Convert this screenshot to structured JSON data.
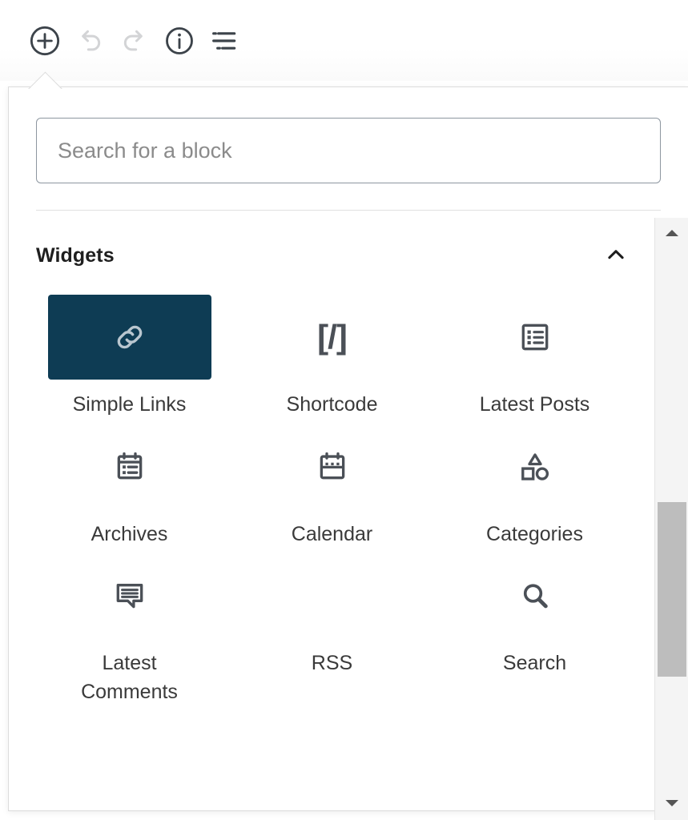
{
  "toolbar": {
    "buttons": [
      {
        "name": "add-block-button",
        "label": "Add block",
        "icon": "plus-circle-icon",
        "state": "active"
      },
      {
        "name": "undo-button",
        "label": "Undo",
        "icon": "undo-icon",
        "state": "disabled"
      },
      {
        "name": "redo-button",
        "label": "Redo",
        "icon": "redo-icon",
        "state": "disabled"
      },
      {
        "name": "details-button",
        "label": "Details",
        "icon": "info-circle-icon",
        "state": "enabled"
      },
      {
        "name": "list-view-button",
        "label": "List view",
        "icon": "list-view-icon",
        "state": "enabled"
      }
    ]
  },
  "inserter": {
    "search": {
      "placeholder": "Search for a block",
      "value": ""
    },
    "category": {
      "title": "Widgets",
      "expanded": true,
      "toggle_icon": "chevron-up-icon"
    },
    "blocks": [
      {
        "label": "Simple Links",
        "icon": "link-icon",
        "selected": true
      },
      {
        "label": "Shortcode",
        "icon": "shortcode-icon",
        "selected": false
      },
      {
        "label": "Latest Posts",
        "icon": "list-view-icon",
        "selected": false
      },
      {
        "label": "Archives",
        "icon": "archive-icon",
        "selected": false
      },
      {
        "label": "Calendar",
        "icon": "calendar-icon",
        "selected": false
      },
      {
        "label": "Categories",
        "icon": "shapes-icon",
        "selected": false
      },
      {
        "label": "Latest Comments",
        "icon": "comment-icon",
        "selected": false
      },
      {
        "label": "RSS",
        "icon": "none",
        "selected": false
      },
      {
        "label": "Search",
        "icon": "search-icon",
        "selected": false
      }
    ]
  },
  "scrollbar": {
    "up_icon": "triangle-up-icon",
    "down_icon": "triangle-down-icon"
  },
  "colors": {
    "selected_tile": "#0e3c54",
    "icon": "#4b5057",
    "text": "#1e1e1e"
  }
}
